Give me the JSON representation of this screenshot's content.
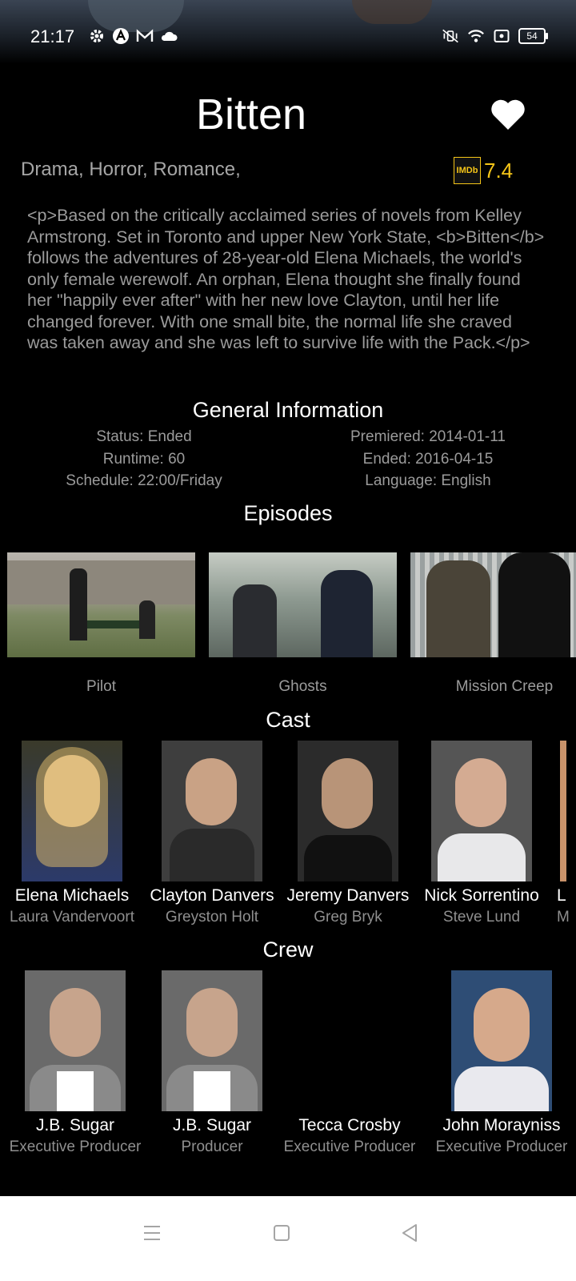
{
  "status_bar": {
    "time": "21:17",
    "battery": "54",
    "left_icons": [
      "gear-icon",
      "app-a-icon",
      "mail-icon",
      "cloud-icon"
    ],
    "right_icons": [
      "mute-vibrate-icon",
      "wifi-icon",
      "screen-record-icon",
      "battery-icon"
    ]
  },
  "show": {
    "title": "Bitten",
    "genres": "Drama, Horror, Romance,",
    "imdb_badge": "IMDb",
    "imdb_rating": "7.4",
    "description": "<p>Based on the critically acclaimed series of novels from Kelley Armstrong. Set in Toronto and upper New York State, <b>Bitten</b> follows the adventures of 28-year-old Elena Michaels, the world's only female werewolf. An orphan, Elena thought she finally found her \"happily ever after\" with her new love Clayton, until her life changed forever. With one small bite, the normal life she craved was taken away and she was left to survive life with the Pack.</p>"
  },
  "general": {
    "heading": "General Information",
    "status": "Status: Ended",
    "runtime": "Runtime: 60",
    "schedule": "Schedule: 22:00/Friday",
    "premiered": "Premiered: 2014-01-11",
    "ended": "Ended: 2016-04-15",
    "language": "Language: English"
  },
  "episodes": {
    "heading": "Episodes",
    "items": [
      {
        "name": "Pilot"
      },
      {
        "name": "Ghosts"
      },
      {
        "name": "Mission Creep"
      }
    ]
  },
  "cast": {
    "heading": "Cast",
    "items": [
      {
        "character": "Elena Michaels",
        "actor": "Laura Vandervoort"
      },
      {
        "character": "Clayton Danvers",
        "actor": "Greyston Holt"
      },
      {
        "character": "Jeremy Danvers",
        "actor": "Greg Bryk"
      },
      {
        "character": "Nick Sorrentino",
        "actor": "Steve Lund"
      },
      {
        "character": "L",
        "actor": "M"
      }
    ]
  },
  "crew": {
    "heading": "Crew",
    "items": [
      {
        "name": "J.B. Sugar",
        "role": "Executive Producer"
      },
      {
        "name": "J.B. Sugar",
        "role": "Producer"
      },
      {
        "name": "Tecca Crosby",
        "role": "Executive Producer"
      },
      {
        "name": "John Morayniss",
        "role": "Executive Producer"
      }
    ]
  },
  "nav": {
    "icons": [
      "menu-icon",
      "home-square-icon",
      "back-triangle-icon"
    ]
  },
  "colors": {
    "background": "#000000",
    "imdb_yellow": "#f5c518",
    "muted_text": "#9b9b9b",
    "nav_bar": "#ffffff"
  }
}
